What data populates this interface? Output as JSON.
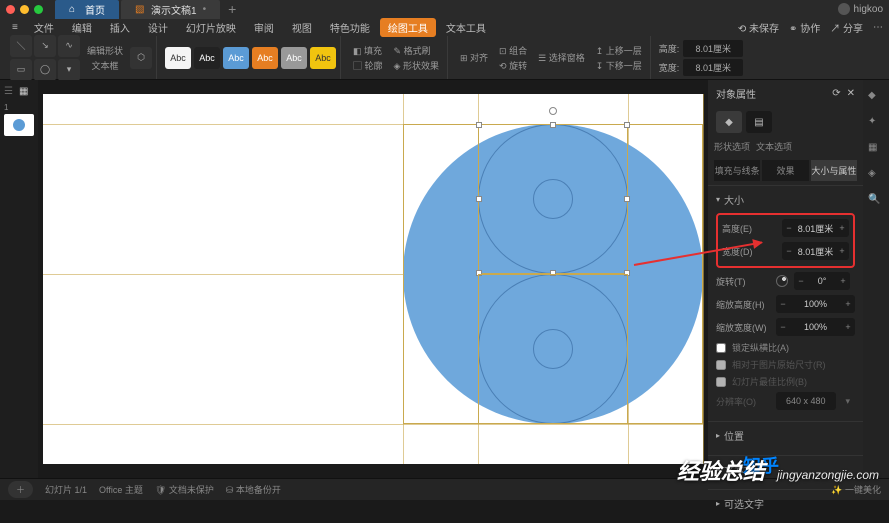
{
  "window": {
    "home_tab": "首页",
    "doc_tab": "演示文稿1",
    "user": "higkoo"
  },
  "menu": {
    "items": [
      "文件",
      "编辑",
      "插入",
      "设计",
      "幻灯片放映",
      "审阅",
      "视图",
      "特色功能",
      "绘图工具",
      "文本工具"
    ],
    "active_index": 8,
    "right": [
      "未保存",
      "协作",
      "分享"
    ]
  },
  "ribbon": {
    "edit_shape": "编辑形状",
    "textbox": "文本框",
    "style_label": "Abc",
    "fill": "填充",
    "outline": "轮廓",
    "shape_effect": "形状效果",
    "format": "格式刷",
    "align": "对齐",
    "rotate": "旋转",
    "select_pane": "选择窗格",
    "group": "组合",
    "up_layer": "上移一层",
    "down_layer": "下移一层",
    "height_label": "高度:",
    "width_label": "宽度:",
    "height_val": "8.01厘米",
    "width_val": "8.01厘米"
  },
  "thumbs": {
    "num": "1"
  },
  "panel": {
    "title": "对象属性",
    "subtab_shape": "形状选项",
    "subtab_text": "文本选项",
    "tabs": [
      "填充与线条",
      "效果",
      "大小与属性"
    ],
    "active_tab": 2,
    "size_section": "大小",
    "height": {
      "label": "高度(E)",
      "value": "8.01厘米"
    },
    "width": {
      "label": "宽度(D)",
      "value": "8.01厘米"
    },
    "rotate": {
      "label": "旋转(T)",
      "value": "0°"
    },
    "scale_h": {
      "label": "缩放高度(H)",
      "value": "100%"
    },
    "scale_w": {
      "label": "缩放宽度(W)",
      "value": "100%"
    },
    "lock_aspect": "锁定纵横比(A)",
    "rel_orig": "相对于图片原始尺寸(R)",
    "slide_best": "幻灯片最佳比例(B)",
    "resolution_label": "分辨率(O)",
    "resolution_val": "640 x 480",
    "pos_section": "位置",
    "textbox_section": "文本框",
    "alt_section": "可选文字"
  },
  "status": {
    "slide_num": "幻灯片 1/1",
    "theme": "Office 主题",
    "protect": "文档未保护",
    "backup": "本地备份开",
    "spellcheck": "一键美化"
  },
  "watermark": {
    "zhihu": "知乎",
    "zh": "经验总结",
    "en": "jingyanzongjie.com"
  }
}
